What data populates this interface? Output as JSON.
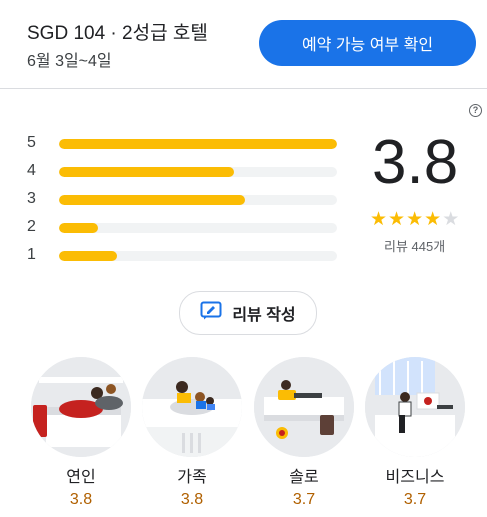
{
  "header": {
    "title": "SGD 104 · 2성급 호텔",
    "dates": "6월 3일~4일",
    "check_availability": "예약 가능 여부 확인"
  },
  "ratings": {
    "breakdown": [
      {
        "stars": "5",
        "fraction": 1.0
      },
      {
        "stars": "4",
        "fraction": 0.63
      },
      {
        "stars": "3",
        "fraction": 0.67
      },
      {
        "stars": "2",
        "fraction": 0.14
      },
      {
        "stars": "1",
        "fraction": 0.21
      }
    ],
    "score": "3.8",
    "stars_filled": 4,
    "review_count": "리뷰 445개",
    "accent_color": "#fbbc04"
  },
  "write_review": {
    "label": "리뷰 작성",
    "icon": "rate-review-icon"
  },
  "help_icon": "help-icon",
  "travelers": [
    {
      "label": "연인",
      "score": "3.8",
      "icon": "couple-illustration"
    },
    {
      "label": "가족",
      "score": "3.8",
      "icon": "family-illustration"
    },
    {
      "label": "솔로",
      "score": "3.7",
      "icon": "solo-illustration"
    },
    {
      "label": "비즈니스",
      "score": "3.7",
      "icon": "business-illustration"
    }
  ]
}
